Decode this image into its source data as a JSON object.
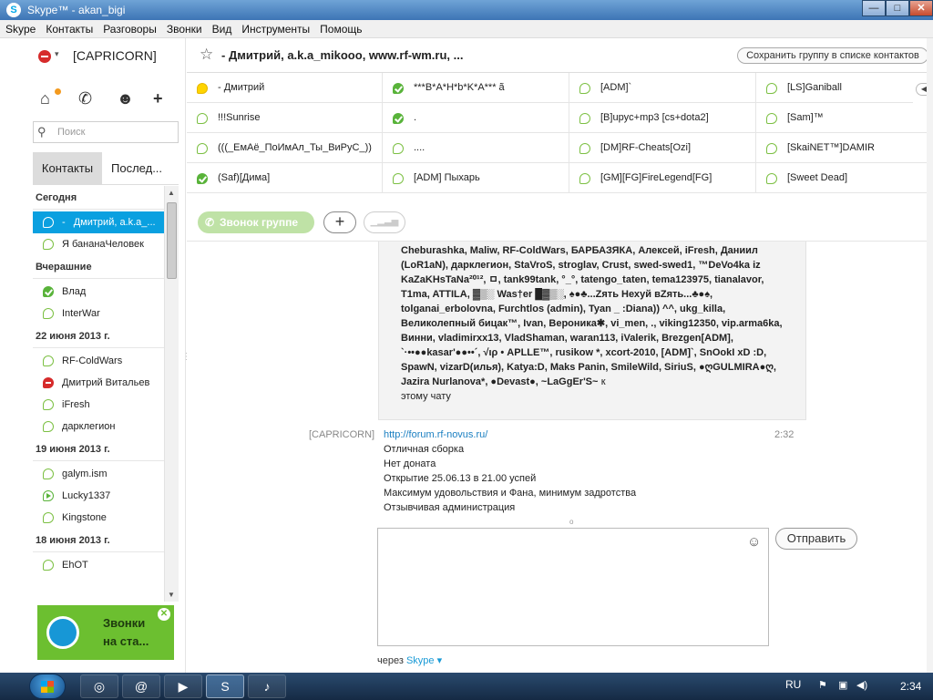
{
  "window": {
    "title": "Skype™ - akan_bigi",
    "logo": "S"
  },
  "window_controls": {
    "minimize": "—",
    "maximize": "□",
    "close": "✕"
  },
  "menu": [
    "Skype",
    "Контакты",
    "Разговоры",
    "Звонки",
    "Вид",
    "Инструменты",
    "Помощь"
  ],
  "profile": {
    "name": "[CAPRICORN]",
    "caret": "▾"
  },
  "nav": {
    "home": "⌂",
    "call": "✆",
    "people": "☻",
    "add": "+"
  },
  "search": {
    "placeholder": "Поиск",
    "icon": "⚲"
  },
  "tabs": {
    "contacts": "Контакты",
    "recent": "Послед..."
  },
  "contact_list": {
    "group_today": "Сегодня",
    "selected": "Дмитрий, a.k.a_...",
    "selected_dash": "-",
    "today_2": "Я бананаЧеловек",
    "group_yesterday": "Вчерашние",
    "y1": "Влад",
    "y2": "InterWar",
    "group_22": "22 июня 2013 г.",
    "d22_1": "RF-ColdWars",
    "d22_2": "Дмитрий Витальев",
    "d22_3": "iFresh",
    "d22_4": "дарклегион",
    "group_19": "19 июня 2013 г.",
    "d19_1": "galym.ism",
    "d19_2": "Lucky1337",
    "d19_3": "Kingstone",
    "group_18": "18 июня 2013 г.",
    "d18_1": "EhOT"
  },
  "scroll": {
    "up": "▲",
    "down": "▼"
  },
  "promo": {
    "line1": "Звонки",
    "line2": "на ста...",
    "close": "✕"
  },
  "chat_header": {
    "star": "☆",
    "title": "- Дмитрий, a.k.a_mikooo, www.rf-wm.ru, ...",
    "save_group": "Сохранить группу в списке контактов"
  },
  "participants": {
    "c1": "- Дмитрий",
    "c2": "***B*A*H*b*K*A*** ã",
    "c3": "[ADM]`",
    "c4": "[LS]Ganiball",
    "c5": "!!!Sunrise",
    "c6": ".",
    "c7": "[B]upyc+mp3 [cs+dota2]",
    "c8": "[Sam]™",
    "c9": "(((_ЕмАё_ПоИмАл_Ты_ВиРуС_))",
    "c10": "....",
    "c11": "[DM]RF-Cheats[Ozi]",
    "c12": "[SkaiNET™]DAMIR",
    "c13": "(Saf)[Дима]",
    "c14": "[ADM] Пыхарь",
    "c15": "[GM][FG]FireLegend[FG]",
    "c16": "[Sweet Dead]",
    "grid_scroll": "◀"
  },
  "actions": {
    "call_group": "Звонок группе",
    "phone": "✆",
    "plus": "+",
    "signal": "▁▂▃▅"
  },
  "messages": {
    "ellipsis": "...",
    "bubble_names": "Cheburashka, Maliw, RF-ColdWars, БАРБАЗЯКА, Алексей, iFresh, Даниил (LoR1aN), дарклегион, StaVroS, stroglav, Crust, swed-swed1, ™DeVo4ka iz KaZaKHsTaNa²⁰¹², ㅁ, tank99tank, °_°, tatengo_taten, tema123975, tianalavor, T1ma, ATTILA, ▓▒░ Was†er █▓▒░, ♠●♣...Zять Hехуй вZять...♣●♠, tolganai_erbolovna, Furchtlos (admin), Tyan _ :Diana)) ^^, ukg_killa, Великолепный бицак™, Ivan, Вероника✱, vi_men, ., viking12350, vip.arma6ka, Винни, vladimirxx13, VladShaman, waran113, iValerik, Brezgen[ADM], `·••●●kasar'●●••´, √ιρ • APLLE™, rusikow *, xcort-2010, [ADM]`, SnOokI xD :D, SpawN, vizarD(илья), Katya:D, Maks Panin, SmileWild, SiriuS, ●ღGULMIRA●ღ, Jazira Nurlanova*, ●Devast●, ~LaGgEr'S~",
    "bubble_tail_inline": "к",
    "bubble_tail": "этому чату",
    "sender": "[CAPRICORN]",
    "time": "2:32",
    "link": "http://forum.rf-novus.ru/",
    "line1": "Отличная сборка",
    "line2": "Нет доната",
    "line3": "Открытие 25.06.13 в 21.00 успей",
    "line4": "Максимум удовольствия и Фана, минимум задротства",
    "line5": "Отзывчивая администрация",
    "divider": "o"
  },
  "compose": {
    "emoji": "☺",
    "send": "Отправить",
    "via_prefix": "через",
    "via_brand": "Skype",
    "via_caret": "▾"
  },
  "taskbar": {
    "chrome": "◎",
    "chat": "@",
    "media": "▶",
    "skype": "S",
    "other": "♪",
    "lang": "RU",
    "flag": "⚑",
    "net": "▣",
    "vol": "◀)",
    "time": "2:34"
  }
}
